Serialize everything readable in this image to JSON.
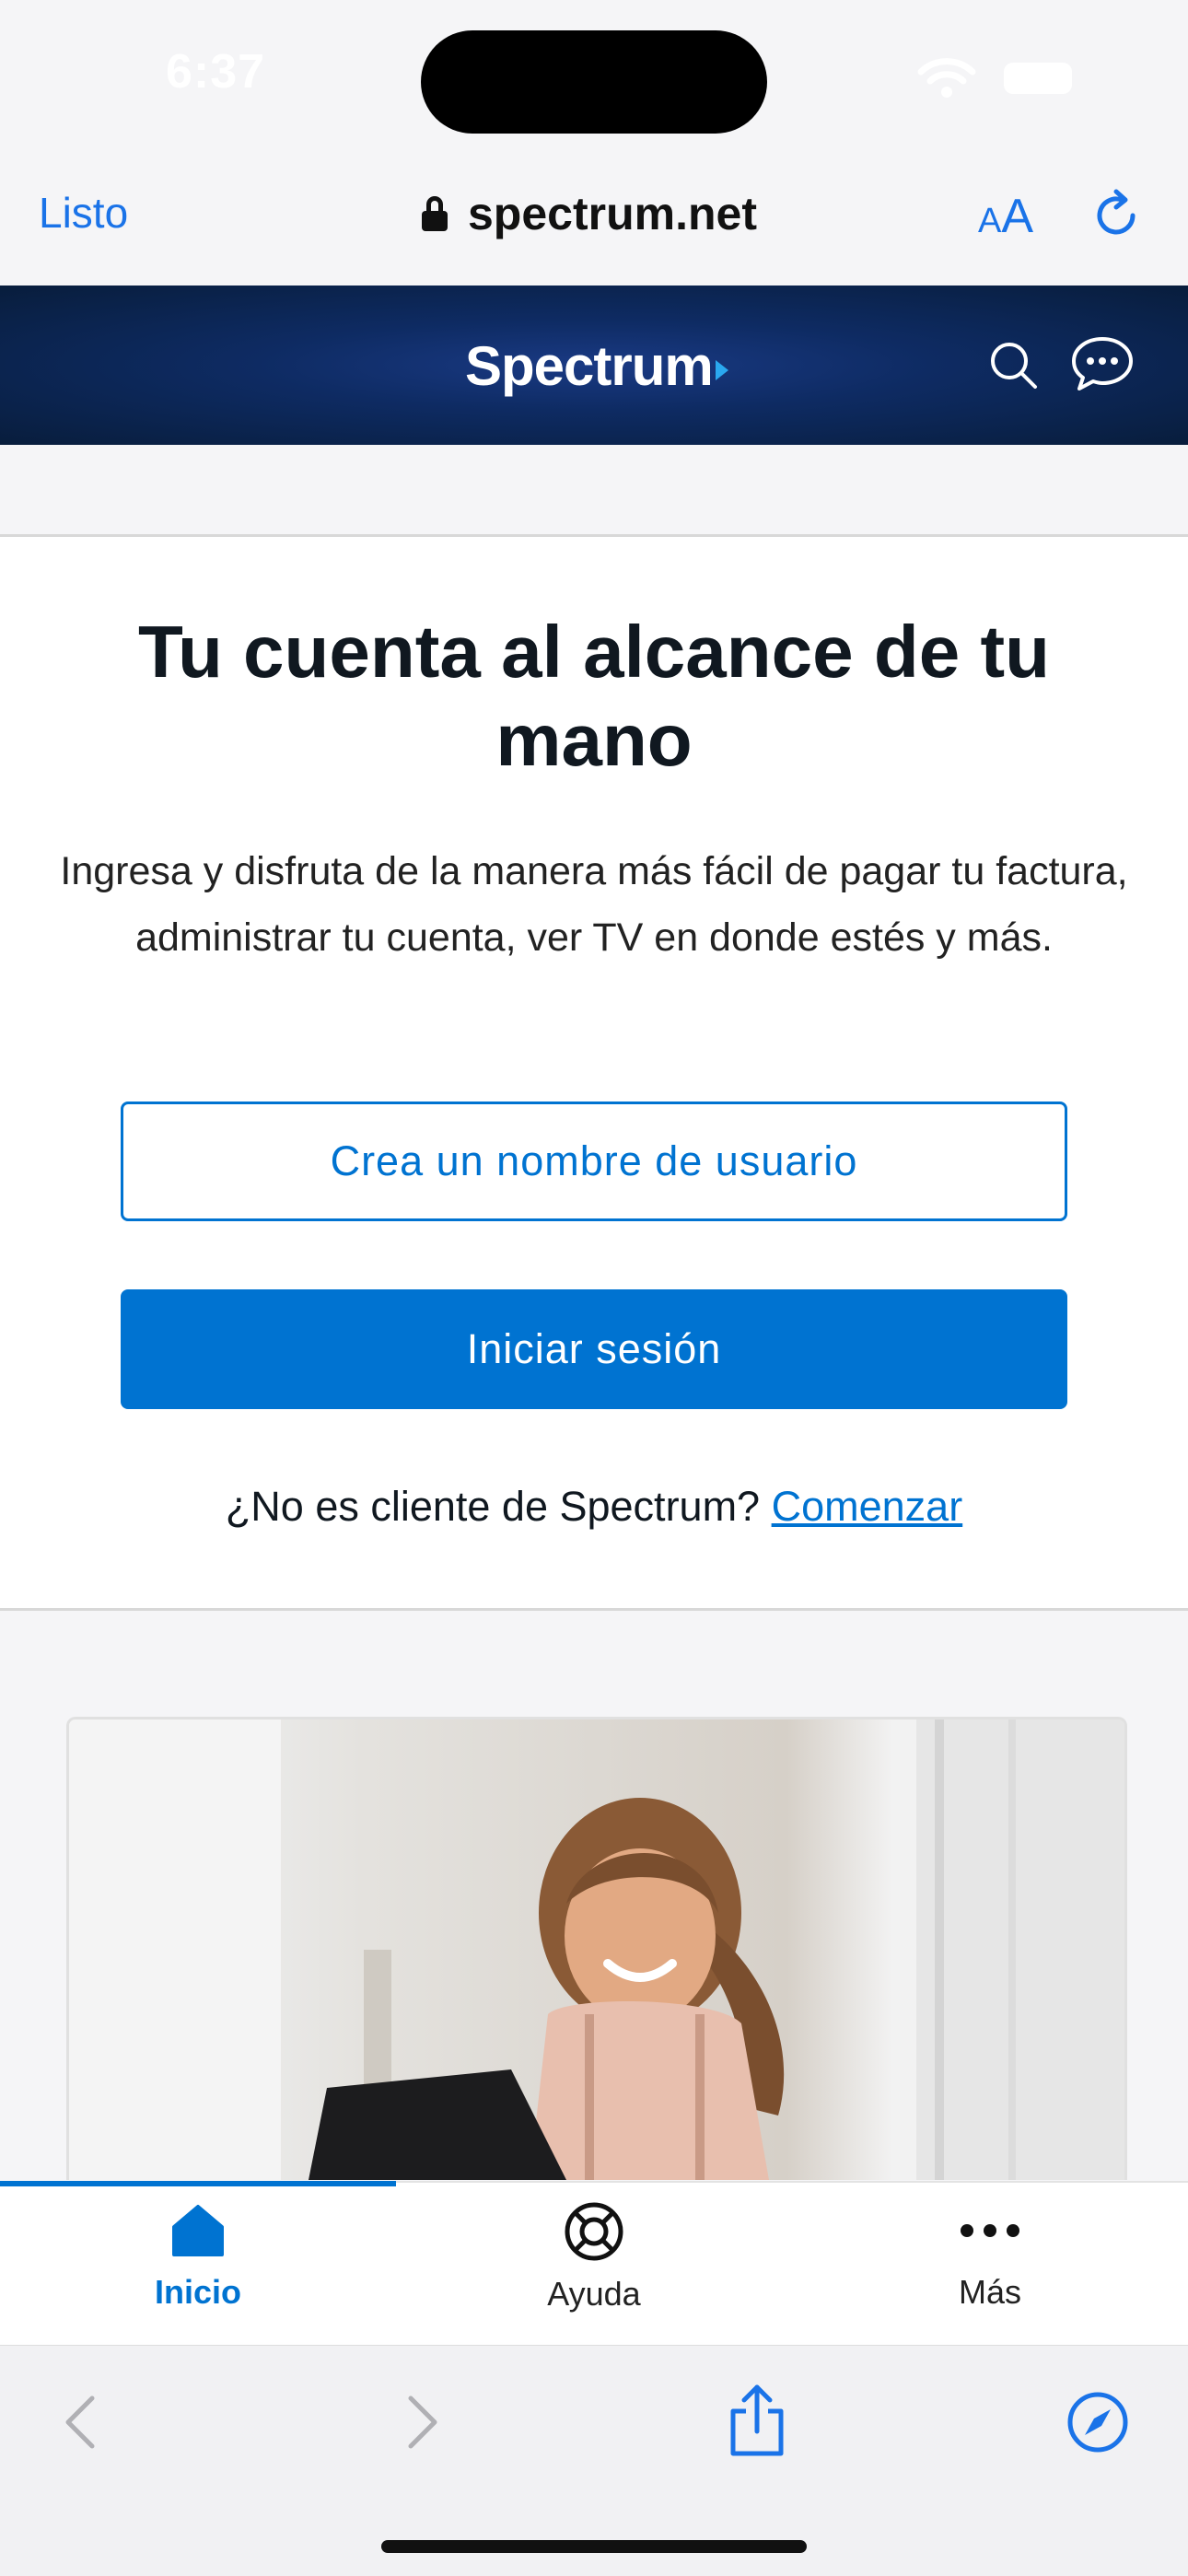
{
  "status_bar": {
    "time": "6:37"
  },
  "browser": {
    "done_label": "Listo",
    "url": "spectrum.net",
    "text_size_small": "A",
    "text_size_big": "A"
  },
  "site_header": {
    "logo": "Spectrum"
  },
  "hero": {
    "title": "Tu cuenta al alcance de tu mano",
    "description": "Ingresa y disfruta de la manera más fácil de pagar tu factura, administrar tu cuenta, ver TV en donde estés y más.",
    "create_username_label": "Crea un nombre de usuario",
    "sign_in_label": "Iniciar sesión",
    "not_customer_text": "¿No es cliente de Spectrum?",
    "get_started_link": "Comenzar"
  },
  "tab_bar": {
    "tabs": [
      {
        "label": "Inicio",
        "icon": "home-icon",
        "active": true
      },
      {
        "label": "Ayuda",
        "icon": "lifebuoy-icon",
        "active": false
      },
      {
        "label": "Más",
        "icon": "more-dots-icon",
        "active": false
      }
    ]
  },
  "colors": {
    "accent": "#0073d1",
    "header_bg": "#0e2b63",
    "safari_blue": "#1a73e8"
  }
}
